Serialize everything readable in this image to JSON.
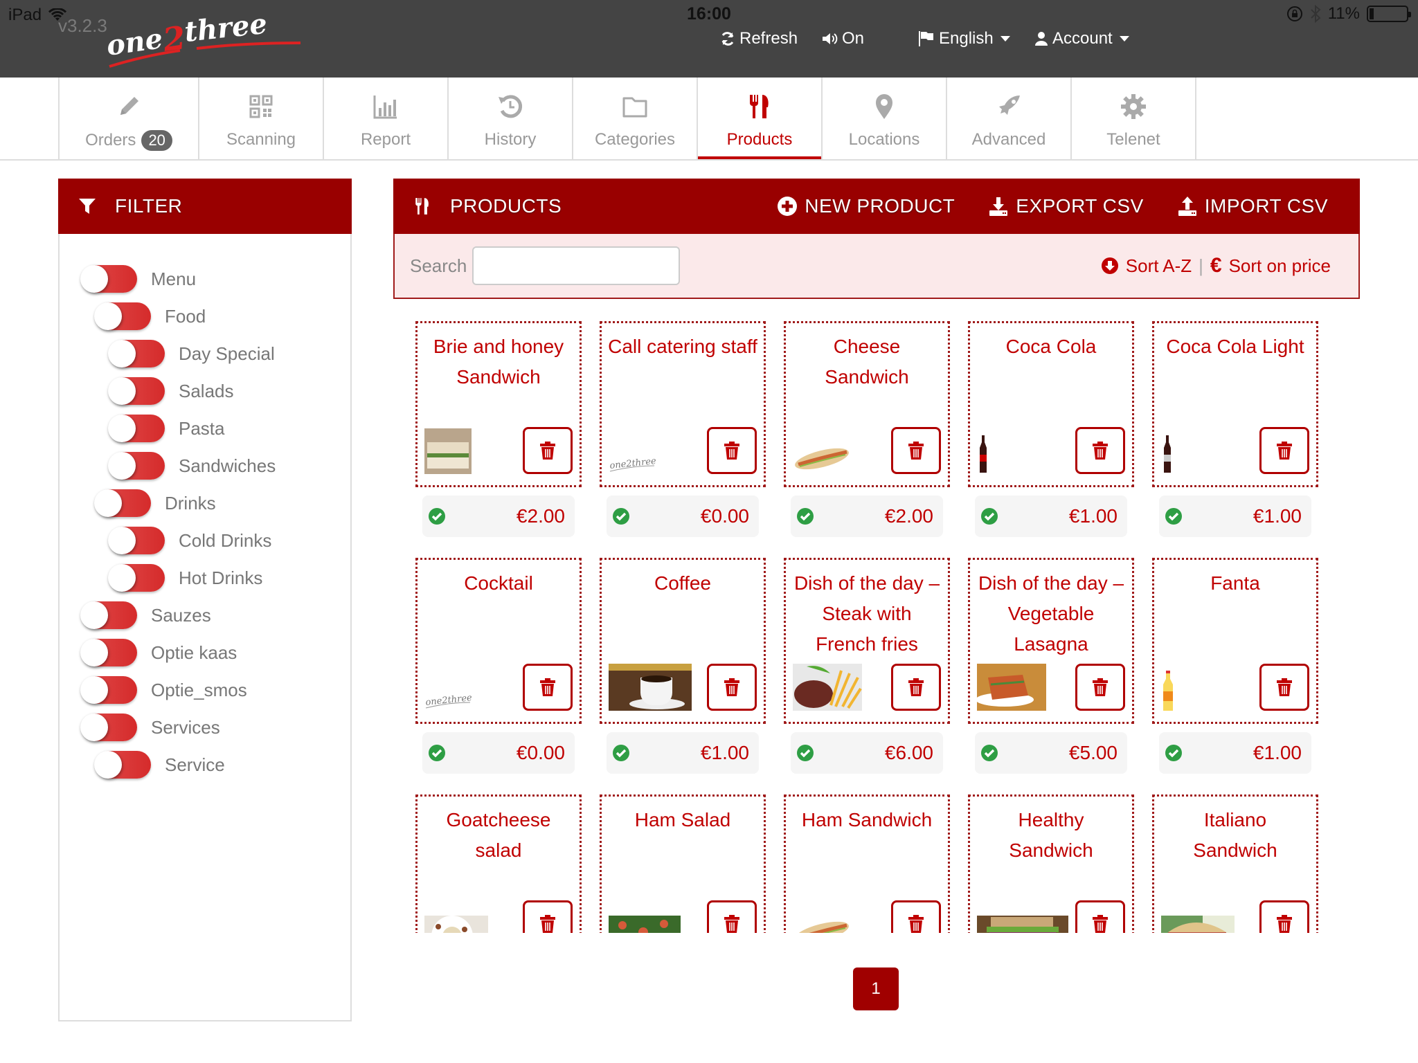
{
  "status_bar": {
    "device": "iPad",
    "time": "16:00",
    "battery": "11%"
  },
  "app": {
    "version": "v3.2.3",
    "logo_text_a": "one",
    "logo_text_b": "2",
    "logo_text_c": "three"
  },
  "topnav": {
    "refresh": "Refresh",
    "sound": "On",
    "language": "English",
    "account": "Account"
  },
  "tabs": [
    {
      "label": "Orders",
      "badge": "20",
      "icon": "pencil-icon"
    },
    {
      "label": "Scanning",
      "icon": "qr-code-icon"
    },
    {
      "label": "Report",
      "icon": "bar-chart-icon"
    },
    {
      "label": "History",
      "icon": "history-icon"
    },
    {
      "label": "Categories",
      "icon": "folder-icon"
    },
    {
      "label": "Products",
      "icon": "cutlery-icon",
      "active": true
    },
    {
      "label": "Locations",
      "icon": "map-marker-icon"
    },
    {
      "label": "Advanced",
      "icon": "rocket-icon"
    },
    {
      "label": "Telenet",
      "icon": "gear-icon"
    }
  ],
  "filter": {
    "title": "FILTER",
    "items": [
      {
        "label": "Menu",
        "level": 0
      },
      {
        "label": "Food",
        "level": 1
      },
      {
        "label": "Day Special",
        "level": 2
      },
      {
        "label": "Salads",
        "level": 2
      },
      {
        "label": "Pasta",
        "level": 2
      },
      {
        "label": "Sandwiches",
        "level": 2
      },
      {
        "label": "Drinks",
        "level": 1
      },
      {
        "label": "Cold Drinks",
        "level": 2
      },
      {
        "label": "Hot Drinks",
        "level": 2
      },
      {
        "label": "Sauzes",
        "level": 0
      },
      {
        "label": "Optie kaas",
        "level": 0
      },
      {
        "label": "Optie_smos",
        "level": 0
      },
      {
        "label": "Services",
        "level": 0
      },
      {
        "label": "Service",
        "level": 1
      }
    ]
  },
  "products": {
    "title": "PRODUCTS",
    "new_product": "NEW PRODUCT",
    "export_csv": "EXPORT CSV",
    "import_csv": "IMPORT CSV",
    "search_label": "Search",
    "search_value": "",
    "sort_az": "Sort A-Z",
    "sort_separator": "|",
    "sort_price": "Sort on price",
    "items": [
      {
        "name": "Brie and honey Sandwich",
        "price": "€2.00",
        "image": "sandwich"
      },
      {
        "name": "Call catering staff",
        "price": "€0.00",
        "image": "logo"
      },
      {
        "name": "Cheese Sandwich",
        "price": "€2.00",
        "image": "baguette"
      },
      {
        "name": "Coca Cola",
        "price": "€1.00",
        "image": "cola-bottle"
      },
      {
        "name": "Coca Cola Light",
        "price": "€1.00",
        "image": "cola-light-bottle"
      },
      {
        "name": "Cocktail",
        "price": "€0.00",
        "image": "logo"
      },
      {
        "name": "Coffee",
        "price": "€1.00",
        "image": "coffee"
      },
      {
        "name": "Dish of the day – Steak with French fries",
        "price": "€6.00",
        "image": "steak"
      },
      {
        "name": "Dish of the day – Vegetable Lasagna",
        "price": "€5.00",
        "image": "lasagna"
      },
      {
        "name": "Fanta",
        "price": "€1.00",
        "image": "fanta-bottle"
      },
      {
        "name": "Goatcheese salad",
        "price": "",
        "image": "salad"
      },
      {
        "name": "Ham Salad",
        "price": "",
        "image": "salad2"
      },
      {
        "name": "Ham Sandwich",
        "price": "",
        "image": "baguette"
      },
      {
        "name": "Healthy Sandwich",
        "price": "",
        "image": "sandwich2"
      },
      {
        "name": "Italiano Sandwich",
        "price": "",
        "image": "sub"
      }
    ]
  },
  "pagination": {
    "current": "1"
  },
  "colors": {
    "brand": "#990000",
    "accent": "#c00000",
    "ok": "#2e9e44"
  }
}
